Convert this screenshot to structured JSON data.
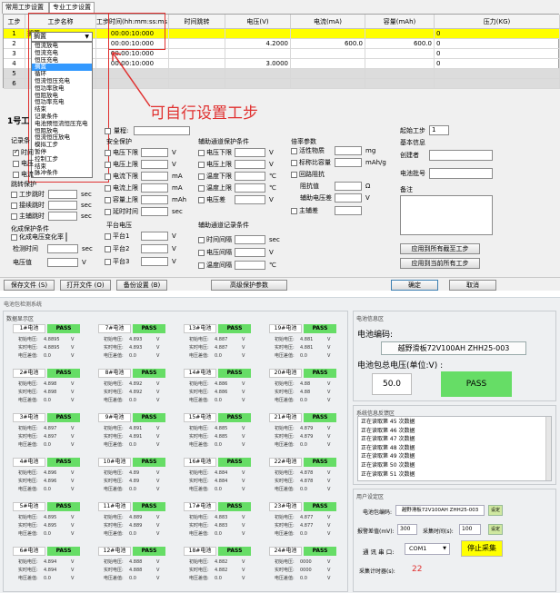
{
  "top_window": {
    "tabs": [
      "常用工步设置",
      "专业工步设置"
    ],
    "columns": [
      "工步",
      "工步名称",
      "工步时间(hh:mm:ss:ms)",
      "时间跳转",
      "电压(V)",
      "电流(mA)",
      "容量(mAh)",
      "压力(KG)"
    ],
    "rows": [
      {
        "no": "1",
        "name": "搁置",
        "time": "00:00:10:000",
        "voltage": "",
        "current": "",
        "capacity": "",
        "pressure": "0"
      },
      {
        "no": "2",
        "name": "",
        "time": "00:00:10:000",
        "voltage": "4.2000",
        "current": "600.0",
        "capacity": "600.0",
        "pressure": "0"
      },
      {
        "no": "3",
        "name": "",
        "time": "00:00:10:000",
        "voltage": "",
        "current": "",
        "capacity": "",
        "pressure": "0"
      },
      {
        "no": "4",
        "name": "",
        "time": "00:00:10:000",
        "voltage": "3.0000",
        "current": "",
        "capacity": "",
        "pressure": "0"
      },
      {
        "no": "5",
        "name": "",
        "time": "",
        "voltage": "",
        "current": "",
        "capacity": "",
        "pressure": ""
      },
      {
        "no": "6",
        "name": "",
        "time": "",
        "voltage": "",
        "current": "",
        "capacity": "",
        "pressure": ""
      }
    ],
    "combo_value": "搁置",
    "dropdown_items": [
      "恒流放电",
      "恒流充电",
      "恒压充电",
      "搁置",
      "循环",
      "恒流恒压充电",
      "恒功率放电",
      "恒阻放电",
      "恒功率充电",
      "结束",
      "记录条件",
      "电池预恒流恒压充电",
      "恒阻放电",
      "恒流恒压放电",
      "模拟工步",
      "暂停",
      "控制工步",
      "结束",
      "脉冲条件"
    ],
    "dropdown_highlight": 3,
    "callout": "可自行设置工步",
    "step_label": "1号工",
    "range_label": "量程:",
    "left_labels": [
      "记录条",
      "时间",
      "电压",
      "电流"
    ],
    "jump_title": "跳转保护",
    "jump_rows": [
      "工步跳时",
      "接续跳时",
      "主辅跳时"
    ],
    "jump_unit": "sec",
    "chem_title": "化成保护条件",
    "chem_rows": [
      "化成电压变化率",
      "检测时间",
      "电压值"
    ],
    "chem_units": [
      "sec",
      "V"
    ],
    "safety_title": "安全保护",
    "safety_rows": [
      "电压下限",
      "电压上限",
      "电流下限",
      "电流上限",
      "容量上限",
      "延时时间"
    ],
    "safety_units": [
      "V",
      "V",
      "mA",
      "mA",
      "mAh",
      "sec"
    ],
    "platform_title": "平台电压",
    "platform_rows": [
      "平台1",
      "平台2",
      "平台3"
    ],
    "aux_title": "辅助通道保护条件",
    "aux_rows": [
      "电压下限",
      "电压上限",
      "温度下限",
      "温度上限",
      "电压差"
    ],
    "aux_units": [
      "V",
      "V",
      "℃",
      "℃",
      "V"
    ],
    "aux_rec_title": "辅助通道记录条件",
    "aux_rec_rows": [
      "时间间隔",
      "电压间隔",
      "温度间隔"
    ],
    "aux_rec_units": [
      "sec",
      "V",
      "℃"
    ],
    "formation_title": "倍率参数",
    "formation_rows": [
      "活性物质",
      "标称比容量"
    ],
    "formation_units": [
      "mg",
      "mAh/g"
    ],
    "impedance_label": "回路阻抗",
    "impedance_rows": [
      "阻抗值",
      "辅助电压差"
    ],
    "impedance_units": [
      "Ω",
      "V"
    ],
    "main_aux": "主辅差",
    "start_step_label": "起始工步",
    "start_step_value": "1",
    "basic_info": "基本信息",
    "creator": "创建者",
    "battery_no": "电池批号",
    "remark": "备注",
    "apply_all": "应用到所有截至工步",
    "apply_current": "应用到当前所有工步",
    "bottom_buttons": [
      "保存文件 (S)",
      "打开文件 (O)",
      "备份设置 (B)",
      "高级保护参数",
      "确定",
      "取消"
    ]
  },
  "bottom_app": {
    "title": "电池包检测系统",
    "data_area_title": "数据显示区",
    "cells": [
      {
        "name": "1#电池",
        "pass": "PASS",
        "r1": "4.8895",
        "r2": "4.8895",
        "r3": "0.0"
      },
      {
        "name": "7#电池",
        "pass": "PASS",
        "r1": "4.893",
        "r2": "4.893",
        "r3": "0.0"
      },
      {
        "name": "13#电池",
        "pass": "PASS",
        "r1": "4.887",
        "r2": "4.887",
        "r3": "0.0"
      },
      {
        "name": "19#电池",
        "pass": "PASS",
        "r1": "4.881",
        "r2": "4.881",
        "r3": "0.0"
      },
      {
        "name": "2#电池",
        "pass": "PASS",
        "r1": "4.898",
        "r2": "4.898",
        "r3": "0.0"
      },
      {
        "name": "8#电池",
        "pass": "PASS",
        "r1": "4.892",
        "r2": "4.892",
        "r3": "0.0"
      },
      {
        "name": "14#电池",
        "pass": "PASS",
        "r1": "4.886",
        "r2": "4.886",
        "r3": "0.0"
      },
      {
        "name": "20#电池",
        "pass": "PASS",
        "r1": "4.88",
        "r2": "4.88",
        "r3": "0.0"
      },
      {
        "name": "3#电池",
        "pass": "PASS",
        "r1": "4.897",
        "r2": "4.897",
        "r3": "0.0"
      },
      {
        "name": "9#电池",
        "pass": "PASS",
        "r1": "4.891",
        "r2": "4.891",
        "r3": "0.0"
      },
      {
        "name": "15#电池",
        "pass": "PASS",
        "r1": "4.885",
        "r2": "4.885",
        "r3": "0.0"
      },
      {
        "name": "21#电池",
        "pass": "PASS",
        "r1": "4.879",
        "r2": "4.879",
        "r3": "0.0"
      },
      {
        "name": "4#电池",
        "pass": "PASS",
        "r1": "4.896",
        "r2": "4.896",
        "r3": "0.0"
      },
      {
        "name": "10#电池",
        "pass": "PASS",
        "r1": "4.89",
        "r2": "4.89",
        "r3": "0.0"
      },
      {
        "name": "16#电池",
        "pass": "PASS",
        "r1": "4.884",
        "r2": "4.884",
        "r3": "0.0"
      },
      {
        "name": "22#电池",
        "pass": "PASS",
        "r1": "4.878",
        "r2": "4.878",
        "r3": "0.0"
      },
      {
        "name": "5#电池",
        "pass": "PASS",
        "r1": "4.895",
        "r2": "4.895",
        "r3": "0.0"
      },
      {
        "name": "11#电池",
        "pass": "PASS",
        "r1": "4.889",
        "r2": "4.889",
        "r3": "0.0"
      },
      {
        "name": "17#电池",
        "pass": "PASS",
        "r1": "4.883",
        "r2": "4.883",
        "r3": "0.0"
      },
      {
        "name": "23#电池",
        "pass": "PASS",
        "r1": "4.877",
        "r2": "4.877",
        "r3": "0.0"
      },
      {
        "name": "6#电池",
        "pass": "PASS",
        "r1": "4.894",
        "r2": "4.894",
        "r3": "0.0"
      },
      {
        "name": "12#电池",
        "pass": "PASS",
        "r1": "4.888",
        "r2": "4.888",
        "r3": "0.0"
      },
      {
        "name": "18#电池",
        "pass": "PASS",
        "r1": "4.882",
        "r2": "4.882",
        "r3": "0.0"
      },
      {
        "name": "24#电池",
        "pass": "PASS",
        "r1": "0000",
        "r2": "0000",
        "r3": "0.0"
      }
    ],
    "cell_row_labels": [
      "初始电压:",
      "实时电压:",
      "电压差值:"
    ],
    "cell_unit": "V",
    "info_title": "电池信息区",
    "battery_code_label": "电池编码:",
    "battery_code": "越野滑板72V100AH ZHH25-003",
    "total_voltage_label": "电池包总电压(单位:V) :",
    "total_voltage": "50.0",
    "total_pass": "PASS",
    "log_title": "系统信息反馈区",
    "log_lines": [
      "正在读取第 45 次数据",
      "正在读取第 46 次数据",
      "正在读取第 47 次数据",
      "正在读取第 48 次数据",
      "正在读取第 49 次数据",
      "正在读取第 50 次数据",
      "正在读取第 51 次数据"
    ],
    "user_title": "用户设定区",
    "pack_code_label": "电池包编码:",
    "pack_code": "越野滑板72V100AH ZHH25-003",
    "set_label": "设定",
    "alarm_label": "报警差值(mV):",
    "alarm_value": "300",
    "interval_label": "采集时间(s):",
    "interval_value": "100",
    "port_label": "通 讯 串 口:",
    "port_value": "COM1",
    "stop_button": "停止采集",
    "count_label": "采集计时器(s):",
    "count_value": "22",
    "colors": {
      "pass": "#66dd66",
      "highlight": "#ffff00",
      "callout": "#e0302f",
      "stop": "#ffff00"
    }
  }
}
